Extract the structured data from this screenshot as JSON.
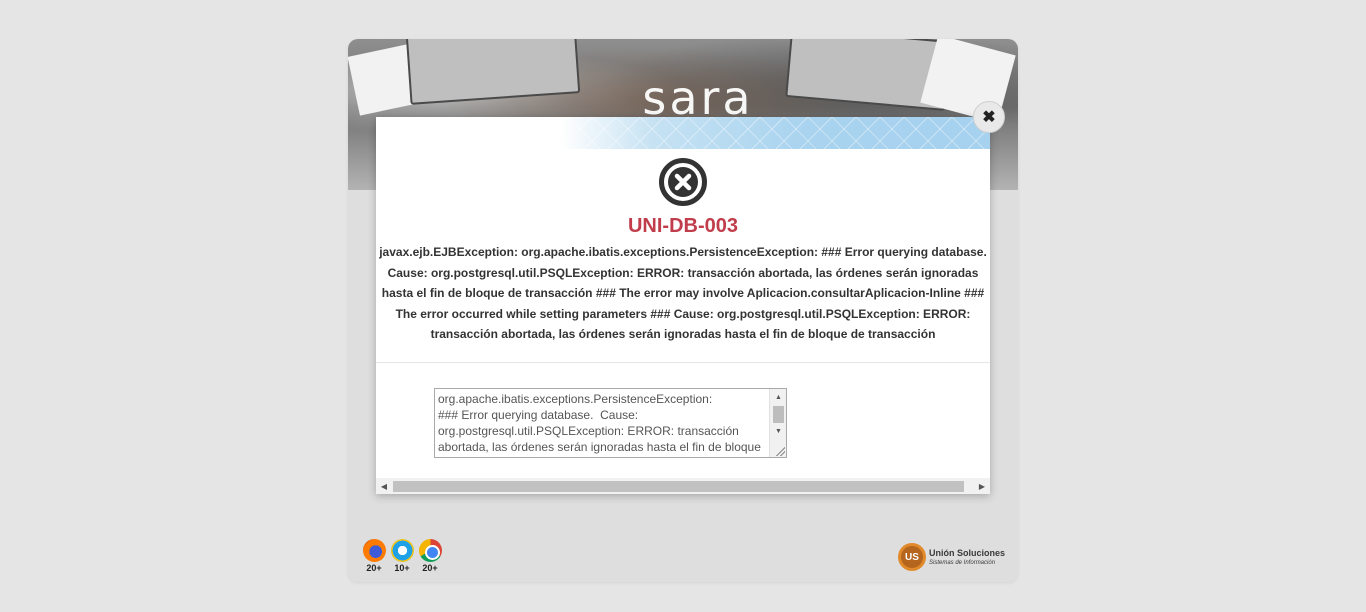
{
  "brand": {
    "logo_text": "sara"
  },
  "browsers": [
    {
      "name": "firefox",
      "version": "20+"
    },
    {
      "name": "internet-explorer",
      "version": "10+"
    },
    {
      "name": "chrome",
      "version": "20+"
    }
  ],
  "company": {
    "mark": "US",
    "name": "Unión Soluciones",
    "tagline": "Sistemas de Información"
  },
  "modal": {
    "close_label": "✖",
    "icon": "error-x-circle-icon",
    "error_code": "UNI-DB-003",
    "error_message": "javax.ejb.EJBException: org.apache.ibatis.exceptions.PersistenceException: ### Error querying database. Cause: org.postgresql.util.PSQLException: ERROR: transacción abortada, las órdenes serán ignoradas hasta el fin de bloque de transacción ### The error may involve Aplicacion.consultarAplicacion-Inline ### The error occurred while setting parameters ### Cause: org.postgresql.util.PSQLException: ERROR: transacción abortada, las órdenes serán ignoradas hasta el fin de bloque de transacción",
    "detail_text": "org.apache.ibatis.exceptions.PersistenceException: \n### Error querying database.  Cause: \norg.postgresql.util.PSQLException: ERROR: transacción \nabortada, las órdenes serán ignoradas hasta el fin de bloque",
    "colors": {
      "error_code": "#c23d4b",
      "header_accent": "#a6d2ef"
    }
  }
}
